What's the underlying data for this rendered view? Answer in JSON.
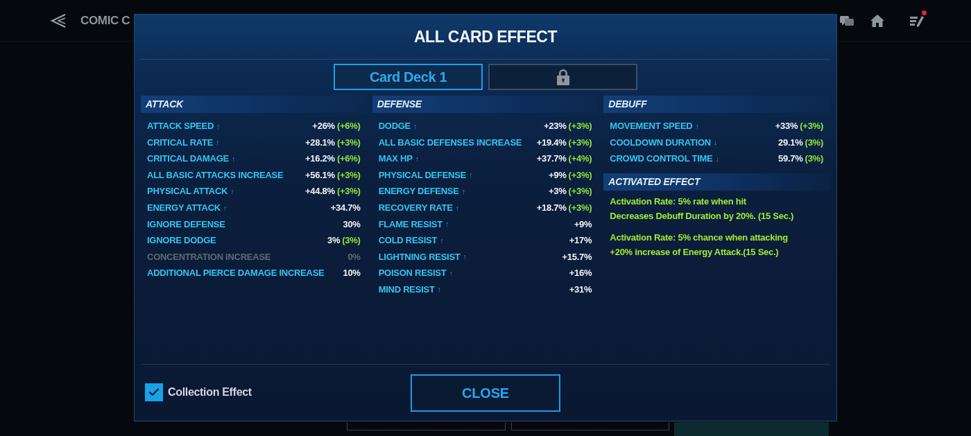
{
  "top_bar": {
    "title": "COMIC C",
    "icons": [
      {
        "kind": "chat"
      },
      {
        "kind": "home"
      },
      {
        "kind": "quests",
        "badge": true
      }
    ]
  },
  "dialog": {
    "title": "ALL CARD EFFECT",
    "tabs": [
      {
        "label": "Card Deck 1",
        "selected": true,
        "locked": false
      },
      {
        "selected": false,
        "locked": true
      }
    ],
    "sections": [
      {
        "title": "ATTACK",
        "stats": [
          {
            "label": "ATTACK SPEED",
            "arrow": "↑",
            "value": "+26%",
            "bonus": "(+6%)",
            "disabled": false
          },
          {
            "label": "CRITICAL RATE",
            "arrow": "↑",
            "value": "+28.1%",
            "bonus": "(+3%)",
            "disabled": false
          },
          {
            "label": "CRITICAL DAMAGE",
            "arrow": "↑",
            "value": "+16.2%",
            "bonus": "(+6%)",
            "disabled": false
          },
          {
            "label": "ALL BASIC ATTACKS INCREASE",
            "value": "+56.1%",
            "bonus": "(+3%)",
            "disabled": false
          },
          {
            "label": "PHYSICAL ATTACK",
            "arrow": "↑",
            "value": "+44.8%",
            "bonus": "(+3%)",
            "disabled": false
          },
          {
            "label": "ENERGY ATTACK",
            "arrow": "↑",
            "value": "+34.7%",
            "disabled": false
          },
          {
            "label": "IGNORE DEFENSE",
            "value": "30%",
            "disabled": false
          },
          {
            "label": "IGNORE DODGE",
            "value": "3%",
            "bonus": "(3%)",
            "disabled": false
          },
          {
            "label": "CONCENTRATION INCREASE",
            "value": "0%",
            "disabled": true
          },
          {
            "label": "ADDITIONAL PIERCE DAMAGE INCREASE",
            "value": "10%",
            "disabled": false
          }
        ]
      },
      {
        "title": "DEFENSE",
        "stats": [
          {
            "label": "DODGE",
            "arrow": "↑",
            "value": "+23%",
            "bonus": "(+3%)",
            "disabled": false
          },
          {
            "label": "ALL BASIC DEFENSES INCREASE",
            "value": "+19.4%",
            "bonus": "(+3%)",
            "disabled": false
          },
          {
            "label": "MAX HP",
            "arrow": "↑",
            "value": "+37.7%",
            "bonus": "(+4%)",
            "disabled": false
          },
          {
            "label": "PHYSICAL DEFENSE",
            "arrow": "↑",
            "value": "+9%",
            "bonus": "(+3%)",
            "disabled": false
          },
          {
            "label": "ENERGY DEFENSE",
            "arrow": "↑",
            "value": "+3%",
            "bonus": "(+3%)",
            "disabled": false
          },
          {
            "label": "RECOVERY RATE",
            "arrow": "↑",
            "value": "+18.7%",
            "bonus": "(+3%)",
            "disabled": false
          },
          {
            "label": "FLAME RESIST",
            "arrow": "↑",
            "value": "+9%",
            "disabled": false
          },
          {
            "label": "COLD RESIST",
            "arrow": "↑",
            "value": "+17%",
            "disabled": false
          },
          {
            "label": "LIGHTNING RESIST",
            "arrow": "↑",
            "value": "+15.7%",
            "disabled": false
          },
          {
            "label": "POISON RESIST",
            "arrow": "↑",
            "value": "+16%",
            "disabled": false
          },
          {
            "label": "MIND RESIST",
            "arrow": "↑",
            "value": "+31%",
            "disabled": false
          }
        ]
      },
      {
        "title": "DEBUFF",
        "stats": [
          {
            "label": "MOVEMENT SPEED",
            "arrow": "↑",
            "value": "+33%",
            "bonus": "(+3%)",
            "disabled": false
          },
          {
            "label": "COOLDOWN DURATION",
            "arrow": "↓",
            "value": "29.1%",
            "bonus": "(3%)",
            "disabled": false
          },
          {
            "label": "CROWD CONTROL TIME",
            "arrow": "↓",
            "value": "59.7%",
            "bonus": "(3%)",
            "disabled": false
          }
        ]
      }
    ],
    "activated_effect": {
      "title": "ACTIVATED EFFECT",
      "effects": [
        {
          "trigger": "Activation Rate: 5% rate when hit",
          "effect": "Decreases Debuff Duration by 20%. (15 Sec.)"
        },
        {
          "trigger": "Activation Rate: 5% chance when attacking",
          "effect": "+20% increase of Energy Attack.(15 Sec.)"
        }
      ]
    },
    "collection_effect": {
      "label": "Collection Effect",
      "checked": true
    },
    "close_button": "CLOSE"
  }
}
